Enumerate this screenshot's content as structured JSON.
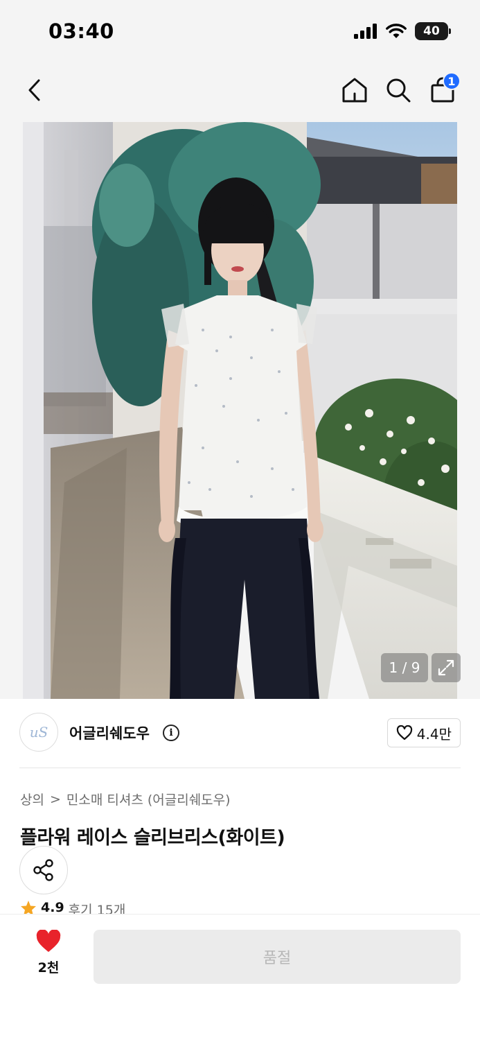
{
  "status_bar": {
    "time": "03:40",
    "battery": "40"
  },
  "nav": {
    "cart_badge": "1"
  },
  "gallery": {
    "counter": "1 / 9"
  },
  "brand": {
    "logo_text": "uS",
    "name": "어글리쉐도우",
    "info_glyph": "i",
    "likes": "4.4만"
  },
  "breadcrumb": {
    "category": "상의",
    "separator": ">",
    "subcategory": "민소매 티셔츠 (어글리쉐도우)"
  },
  "product": {
    "title": "플라워 레이스 슬리브리스(화이트)",
    "rating": "4.9",
    "reviews": "후기 15개"
  },
  "bottom_bar": {
    "wish_count": "2천",
    "soldout_label": "품절"
  },
  "colors": {
    "accent_blue": "#1f6bff",
    "heart_red": "#e8232b",
    "star_orange": "#f5a623",
    "disabled_bg": "#ebebeb",
    "disabled_text": "#b7b7b7"
  },
  "icons": [
    "back-icon",
    "home-icon",
    "search-icon",
    "shopping-bag-icon",
    "expand-icon",
    "info-icon",
    "heart-outline-icon",
    "share-icon",
    "star-icon",
    "heart-filled-icon",
    "signal-icon",
    "wifi-icon",
    "battery-icon"
  ]
}
